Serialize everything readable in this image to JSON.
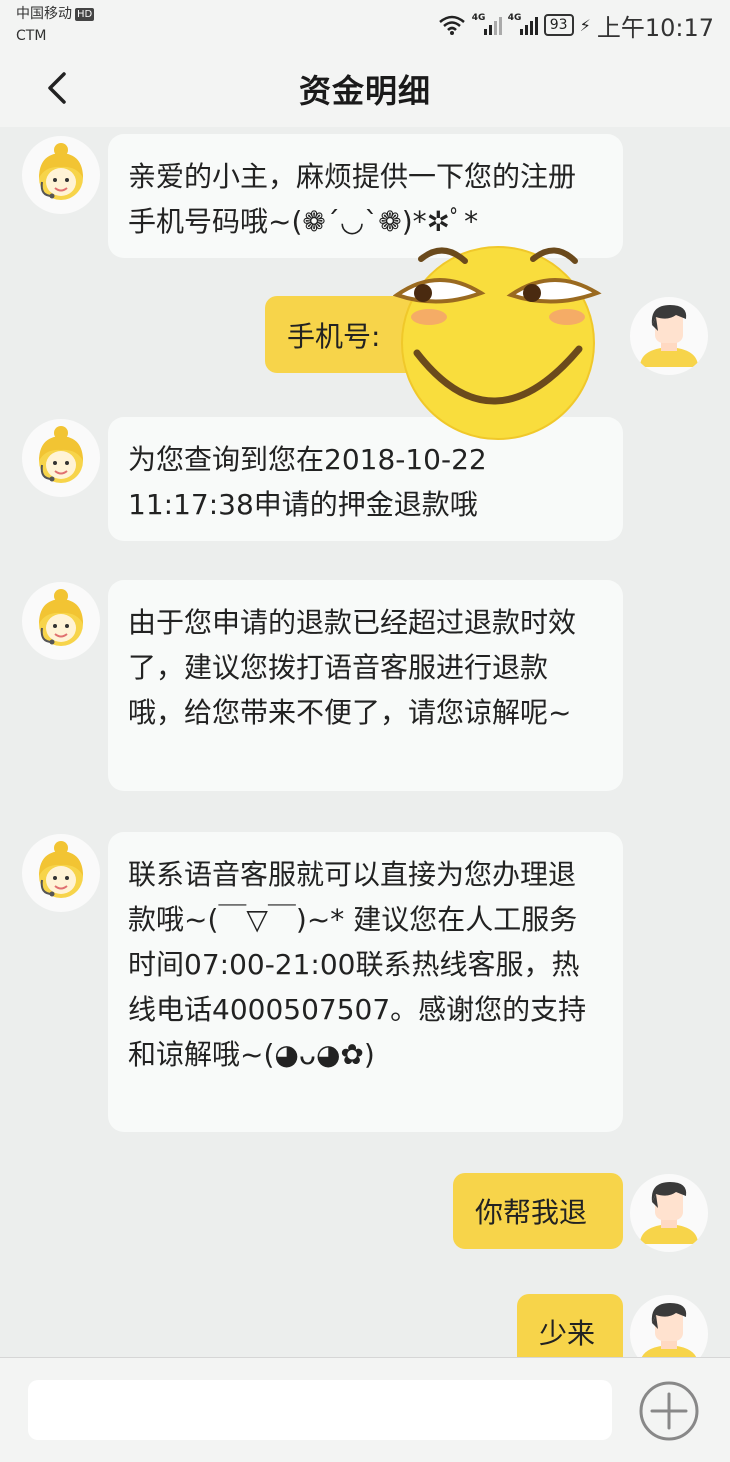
{
  "status_bar": {
    "carrier": "中国移动",
    "hd_badge": "HD",
    "carrier2": "CTM",
    "net1": "4G",
    "net2": "4G",
    "battery": "93",
    "time": "上午10:17"
  },
  "header": {
    "title": "资金明细",
    "back_icon": "chevron-left-icon"
  },
  "messages": [
    {
      "from": "agent",
      "text": "亲爱的小主，麻烦提供一下您的注册手机号码哦~(❁´◡`❁)*✲ﾟ*"
    },
    {
      "from": "user",
      "text": "手机号:"
    },
    {
      "from": "agent",
      "text": "为您查询到您在2018-10-22 11:17:38申请的押金退款哦"
    },
    {
      "from": "agent",
      "text": "由于您申请的退款已经超过退款时效了，建议您拨打语音客服进行退款哦，给您带来不便了，请您谅解呢~"
    },
    {
      "from": "agent",
      "text": "联系语音客服就可以直接为您办理退款哦~(￣▽￣)~* 建议您在人工服务时间07:00-21:00联系热线客服，热线电话4000507507。感谢您的支持和谅解哦~(◕ᴗ◕✿)"
    },
    {
      "from": "user",
      "text": "你帮我退"
    },
    {
      "from": "user",
      "text": "少来"
    }
  ],
  "input": {
    "placeholder": "",
    "add_icon": "plus-circle-icon"
  },
  "colors": {
    "accent": "#f7d44a",
    "background": "#eceeed",
    "bubble_in": "#f8faf9"
  }
}
